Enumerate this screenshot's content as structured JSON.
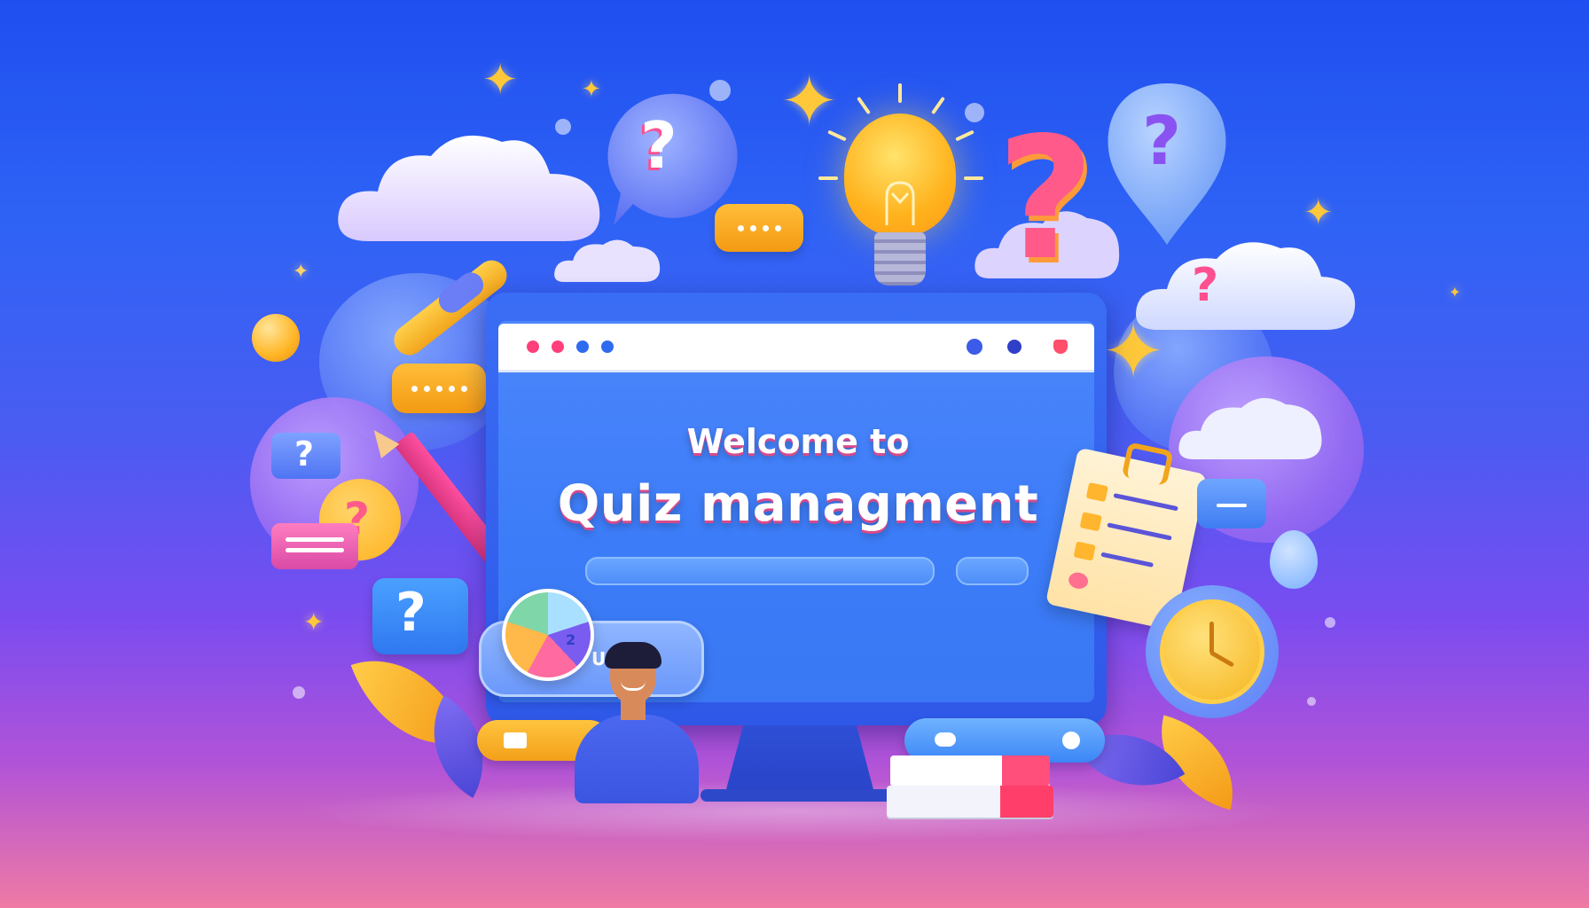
{
  "banner": {
    "line1": "Welcome to",
    "line2": "Quiz managment"
  },
  "pill_label": "U",
  "chart_tag": "2",
  "question_mark": "?",
  "colors": {
    "bg_top": "#1f4ff0",
    "bg_bottom": "#ef7aa4",
    "accent_orange": "#ffb21c",
    "accent_pink": "#ff4f8f",
    "screen_blue": "#3c7cf8"
  },
  "icons": [
    "lightbulb-icon",
    "question-mark-icon",
    "cloud-icon",
    "chat-bubble-icon",
    "pencil-icon",
    "clipboard-icon",
    "clock-icon",
    "pie-chart-icon",
    "book-icon",
    "star-icon",
    "avatar"
  ]
}
